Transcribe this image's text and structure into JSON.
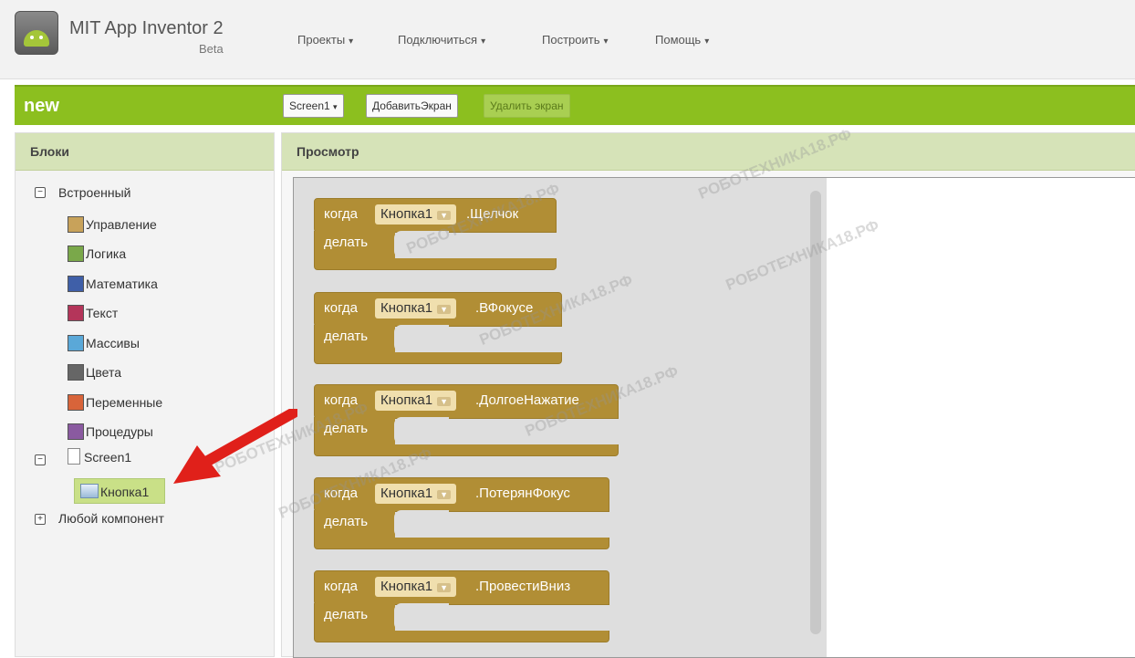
{
  "header": {
    "app_title": "MIT App Inventor 2",
    "app_beta": "Beta",
    "menus": [
      "Проекты",
      "Подключиться",
      "Построить",
      "Помощь"
    ]
  },
  "project_bar": {
    "project_name": "new",
    "screen_select": "Screen1",
    "add_screen": "ДобавитьЭкран",
    "remove_screen": "Удалить экран"
  },
  "blocks_panel": {
    "title": "Блоки",
    "builtin_label": "Встроенный",
    "builtin_items": [
      {
        "label": "Управление",
        "color": "#c8a25a"
      },
      {
        "label": "Логика",
        "color": "#7aa84a"
      },
      {
        "label": "Математика",
        "color": "#3f5fa8"
      },
      {
        "label": "Текст",
        "color": "#b4355a"
      },
      {
        "label": "Массивы",
        "color": "#5aa8d8"
      },
      {
        "label": "Цвета",
        "color": "#666666"
      },
      {
        "label": "Переменные",
        "color": "#d8643a"
      },
      {
        "label": "Процедуры",
        "color": "#8a5aa0"
      }
    ],
    "screen_label": "Screen1",
    "component_label": "Кнопка1",
    "any_component_label": "Любой компонент"
  },
  "workspace": {
    "title": "Просмотр",
    "blocks": [
      {
        "when": "когда",
        "component": "Кнопка1",
        "event": ".Щелчок",
        "do": "делать"
      },
      {
        "when": "когда",
        "component": "Кнопка1",
        "event": ".ВФокусе",
        "do": "делать"
      },
      {
        "when": "когда",
        "component": "Кнопка1",
        "event": ".ДолгоеНажатие",
        "do": "делать"
      },
      {
        "when": "когда",
        "component": "Кнопка1",
        "event": ".ПотерянФокус",
        "do": "делать"
      },
      {
        "when": "когда",
        "component": "Кнопка1",
        "event": ".ПровестиВниз",
        "do": "делать"
      }
    ]
  },
  "watermark": "РОБОТЕХНИКА18.РФ"
}
